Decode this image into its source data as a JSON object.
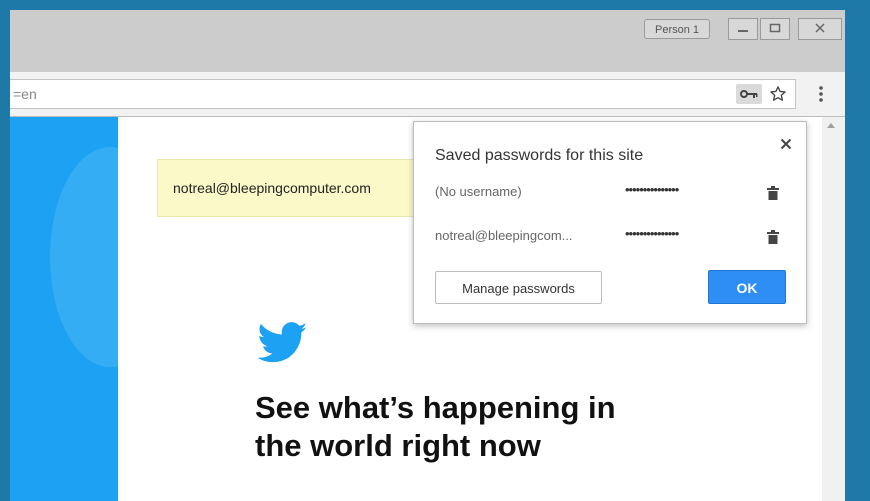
{
  "titlebar": {
    "profile_label": "Person 1"
  },
  "omnibox": {
    "url_fragment": "=en"
  },
  "page": {
    "email_value": "notreal@bleepingcomputer.com",
    "headline_line1": "See what’s happening in",
    "headline_line2": "the world right now"
  },
  "popup": {
    "title": "Saved passwords for this site",
    "entries": [
      {
        "username": "(No username)",
        "password_mask": "•••••••••••••••"
      },
      {
        "username": "notreal@bleepingcom...",
        "password_mask": "•••••••••••••••"
      }
    ],
    "manage_label": "Manage passwords",
    "ok_label": "OK"
  },
  "colors": {
    "desktop": "#1e78a8",
    "twitter_blue": "#1da1f2",
    "ok_button": "#2e8ef4",
    "autofill_yellow": "#fafac8"
  },
  "icons": [
    "key-icon",
    "star-icon",
    "menu-icon",
    "close-icon",
    "trash-icon",
    "twitter-bird-icon",
    "minimize-icon",
    "maximize-icon",
    "window-close-icon"
  ]
}
